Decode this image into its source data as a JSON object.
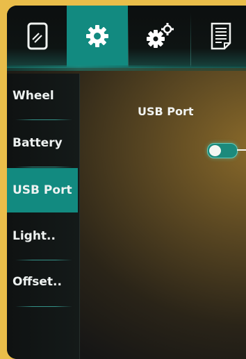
{
  "tabs": [
    {
      "icon": "phone-icon",
      "active": false
    },
    {
      "icon": "gear-icon",
      "active": true
    },
    {
      "icon": "gears-icon",
      "active": false
    },
    {
      "icon": "document-icon",
      "active": false
    }
  ],
  "sidebar": {
    "items": [
      {
        "label": "Wheel"
      },
      {
        "label": "Battery"
      },
      {
        "label": "USB Port"
      },
      {
        "label": "Light.."
      },
      {
        "label": "Offset.."
      }
    ],
    "active_index": 2
  },
  "content": {
    "setting_label": "USB Port",
    "toggle_on": false
  },
  "colors": {
    "accent": "#128a80",
    "frame_border": "#e9bd4a"
  }
}
